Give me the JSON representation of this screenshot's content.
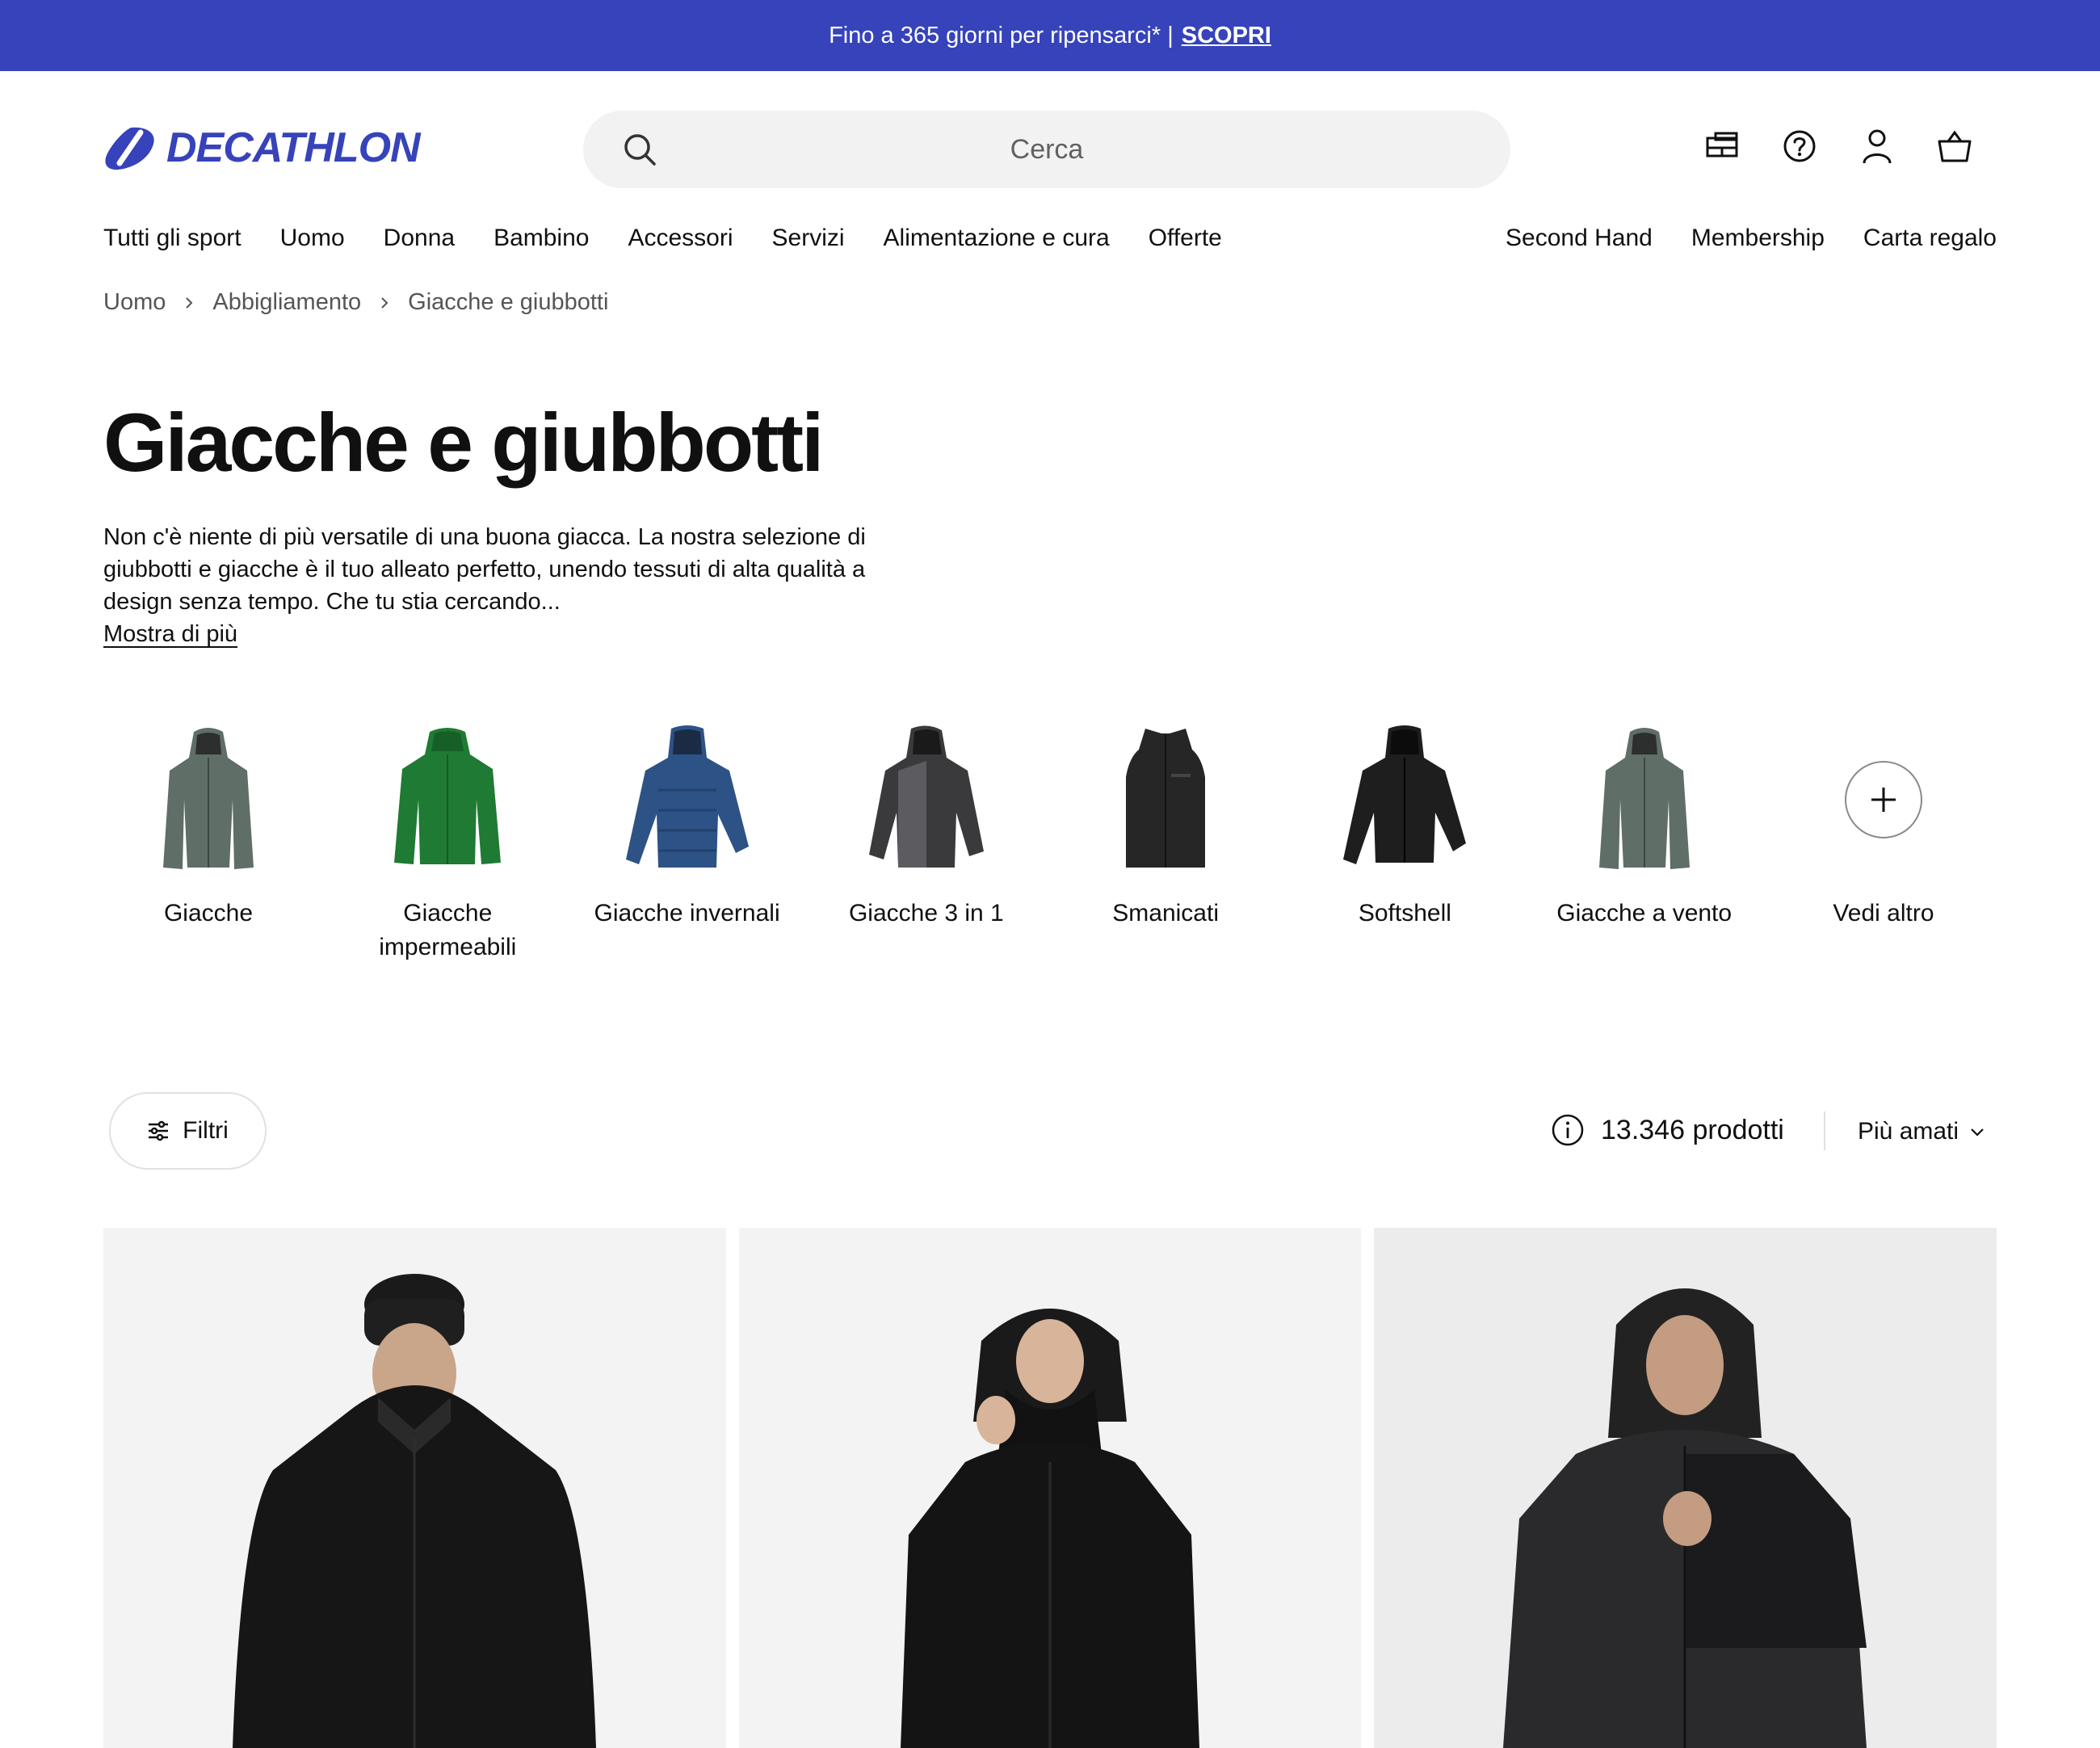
{
  "promo": {
    "text": "Fino a 365 giorni per ripensarci* |",
    "link": "SCOPRI",
    "color": "#3643ba"
  },
  "header": {
    "logo": "DECATHLON",
    "search_placeholder": "Cerca",
    "icons": [
      "store-icon",
      "help-icon",
      "account-icon",
      "cart-icon"
    ]
  },
  "nav": {
    "main": [
      "Tutti gli sport",
      "Uomo",
      "Donna",
      "Bambino",
      "Accessori",
      "Servizi",
      "Alimentazione e cura",
      "Offerte"
    ],
    "secondary": [
      "Second Hand",
      "Membership",
      "Carta regalo"
    ]
  },
  "breadcrumb": [
    "Uomo",
    "Abbigliamento",
    "Giacche e giubbotti"
  ],
  "page": {
    "title": "Giacche e giubbotti",
    "description": "Non c'è niente di più versatile di una buona giacca. La nostra selezione di giubbotti e giacche è il tuo alleato perfetto, unendo tessuti di alta qualità a design senza tempo. Che tu stia cercando...",
    "show_more": "Mostra di più"
  },
  "categories": [
    {
      "label": "Giacche",
      "color": "#5f6e66"
    },
    {
      "label": "Giacche impermeabili",
      "color": "#1f7a34"
    },
    {
      "label": "Giacche invernali",
      "color": "#2d5286"
    },
    {
      "label": "Giacche 3 in 1",
      "color": "#3a3a3d"
    },
    {
      "label": "Smanicati",
      "color": "#262626"
    },
    {
      "label": "Softshell",
      "color": "#1e1e1e"
    },
    {
      "label": "Giacche a vento",
      "color": "#5f6e66"
    },
    {
      "label": "Vedi altro"
    }
  ],
  "toolbar": {
    "filters_label": "Filtri",
    "count": "13.346 prodotti",
    "sort_label": "Più amati"
  }
}
